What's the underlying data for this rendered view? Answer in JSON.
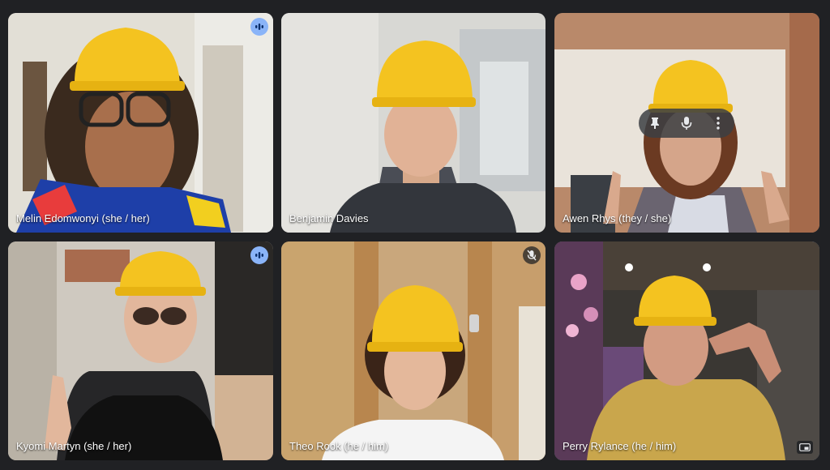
{
  "participants": [
    {
      "name": "Melin Edomwonyi (she / her)",
      "status": "speaking"
    },
    {
      "name": "Benjamin Davies",
      "status": "none"
    },
    {
      "name": "Awen Rhys (they / she)",
      "status": "hover"
    },
    {
      "name": "Kyomi Martyn (she / her)",
      "status": "speaking"
    },
    {
      "name": "Theo Rook (he / him)",
      "status": "muted"
    },
    {
      "name": "Perry Rylance (he / him)",
      "status": "selected"
    }
  ],
  "icons": {
    "speaking": "audio-level-icon",
    "muted": "mic-off-icon",
    "pin": "pin-icon",
    "mic": "mic-icon",
    "more": "more-vert-icon",
    "corner": "picture-in-picture-icon"
  },
  "colors": {
    "background": "#202124",
    "speaking_badge": "#8ab4f8",
    "selected_outline": "#a8c7fa",
    "helmet": "#f4c320"
  }
}
